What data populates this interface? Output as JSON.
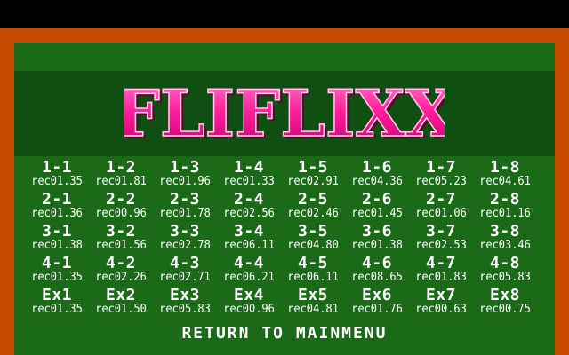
{
  "title": "FLIFLIXX",
  "colors": {
    "background": "#000000",
    "frame": "#c84a00",
    "board": "#1b6a17",
    "banner": "#0f4f12",
    "logo_fill": "#ff1a9a",
    "logo_outline": "#ffd0e6",
    "text": "#ffffff"
  },
  "stages": [
    [
      {
        "stage": "1-1",
        "rec": "rec01.35"
      },
      {
        "stage": "1-2",
        "rec": "rec01.81"
      },
      {
        "stage": "1-3",
        "rec": "rec01.96"
      },
      {
        "stage": "1-4",
        "rec": "rec01.33"
      },
      {
        "stage": "1-5",
        "rec": "rec02.91"
      },
      {
        "stage": "1-6",
        "rec": "rec04.36"
      },
      {
        "stage": "1-7",
        "rec": "rec05.23"
      },
      {
        "stage": "1-8",
        "rec": "rec04.61"
      }
    ],
    [
      {
        "stage": "2-1",
        "rec": "rec01.36"
      },
      {
        "stage": "2-2",
        "rec": "rec00.96"
      },
      {
        "stage": "2-3",
        "rec": "rec01.78"
      },
      {
        "stage": "2-4",
        "rec": "rec02.56"
      },
      {
        "stage": "2-5",
        "rec": "rec02.46"
      },
      {
        "stage": "2-6",
        "rec": "rec01.45"
      },
      {
        "stage": "2-7",
        "rec": "rec01.06"
      },
      {
        "stage": "2-8",
        "rec": "rec01.16"
      }
    ],
    [
      {
        "stage": "3-1",
        "rec": "rec01.38"
      },
      {
        "stage": "3-2",
        "rec": "rec01.56"
      },
      {
        "stage": "3-3",
        "rec": "rec02.78"
      },
      {
        "stage": "3-4",
        "rec": "rec06.11"
      },
      {
        "stage": "3-5",
        "rec": "rec04.80"
      },
      {
        "stage": "3-6",
        "rec": "rec01.38"
      },
      {
        "stage": "3-7",
        "rec": "rec02.53"
      },
      {
        "stage": "3-8",
        "rec": "rec03.46"
      }
    ],
    [
      {
        "stage": "4-1",
        "rec": "rec01.35"
      },
      {
        "stage": "4-2",
        "rec": "rec02.26"
      },
      {
        "stage": "4-3",
        "rec": "rec02.71"
      },
      {
        "stage": "4-4",
        "rec": "rec06.21"
      },
      {
        "stage": "4-5",
        "rec": "rec06.11"
      },
      {
        "stage": "4-6",
        "rec": "rec08.65"
      },
      {
        "stage": "4-7",
        "rec": "rec01.83"
      },
      {
        "stage": "4-8",
        "rec": "rec05.83"
      }
    ],
    [
      {
        "stage": "Ex1",
        "rec": "rec01.35"
      },
      {
        "stage": "Ex2",
        "rec": "rec01.50"
      },
      {
        "stage": "Ex3",
        "rec": "rec05.83"
      },
      {
        "stage": "Ex4",
        "rec": "rec00.96"
      },
      {
        "stage": "Ex5",
        "rec": "rec04.81"
      },
      {
        "stage": "Ex6",
        "rec": "rec01.76"
      },
      {
        "stage": "Ex7",
        "rec": "rec00.63"
      },
      {
        "stage": "Ex8",
        "rec": "rec00.75"
      }
    ]
  ],
  "menu": {
    "return_label": "RETURN TO MAINMENU"
  }
}
